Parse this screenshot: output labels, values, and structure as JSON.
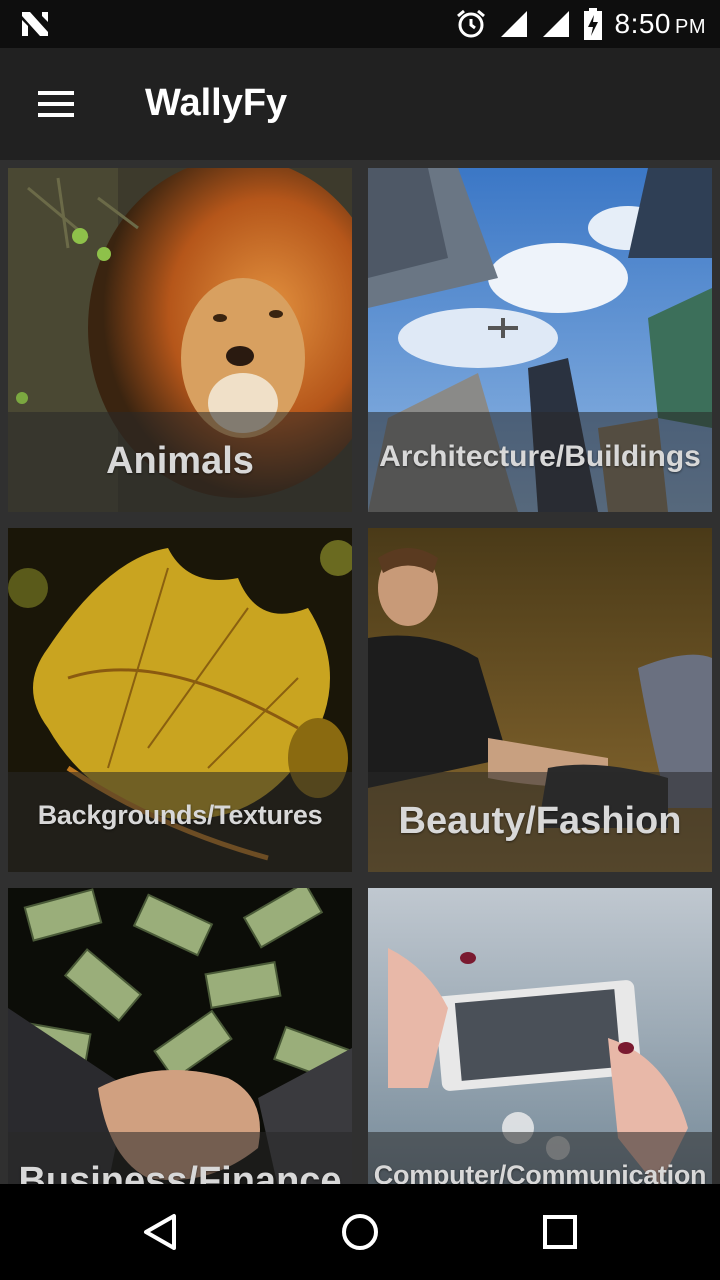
{
  "status_bar": {
    "time": "8:50",
    "ampm": "PM",
    "icons": [
      "n-logo-icon",
      "alarm-icon",
      "signal-icon",
      "signal-icon",
      "battery-charging-icon"
    ]
  },
  "app_bar": {
    "title": "WallyFy",
    "menu_icon": "hamburger-menu-icon"
  },
  "categories": [
    {
      "label": "Animals"
    },
    {
      "label": "Architecture/Buildings"
    },
    {
      "label": "Backgrounds/Textures"
    },
    {
      "label": "Beauty/Fashion"
    },
    {
      "label": "Business/Finance"
    },
    {
      "label": "Computer/Communication"
    }
  ],
  "nav_bar": {
    "icons": [
      "back-icon",
      "home-icon",
      "recents-icon"
    ]
  }
}
